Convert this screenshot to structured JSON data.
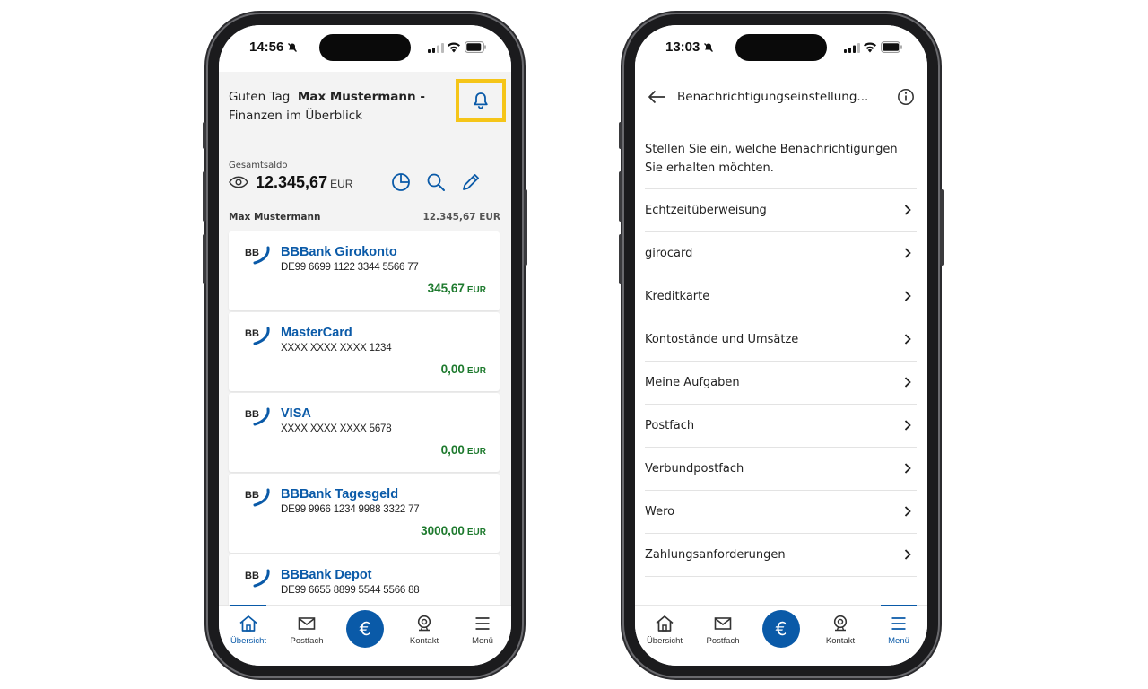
{
  "colors": {
    "brand_blue": "#0a5aa8",
    "positive_green": "#1e7a2e",
    "highlight_yellow": "#f5c518"
  },
  "left_phone": {
    "status": {
      "time": "14:56"
    },
    "greeting": {
      "prefix": "Guten Tag",
      "name": "Max Mustermann -",
      "subtitle": "Finanzen im Überblick"
    },
    "balance": {
      "label": "Gesamtsaldo",
      "amount": "12.345,67",
      "currency": "EUR"
    },
    "owner": {
      "name": "Max Mustermann",
      "total": "12.345,67 EUR"
    },
    "accounts": [
      {
        "logo": "BB",
        "name": "BBBank Girokonto",
        "number": "DE99 6699 1122 3344 5566 77",
        "amount": "345,67",
        "currency": "EUR"
      },
      {
        "logo": "BB",
        "name": "MasterCard",
        "number": "XXXX XXXX XXXX 1234",
        "amount": "0,00",
        "currency": "EUR"
      },
      {
        "logo": "BB",
        "name": "VISA",
        "number": "XXXX XXXX XXXX 5678",
        "amount": "0,00",
        "currency": "EUR"
      },
      {
        "logo": "BB",
        "name": "BBBank Tagesgeld",
        "number": "DE99 9966 1234 9988 3322 77",
        "amount": "3000,00",
        "currency": "EUR"
      },
      {
        "logo": "BB",
        "name": "BBBank Depot",
        "number": "DE99 6655 8899 5544 5566 88",
        "amount": "",
        "currency": ""
      }
    ],
    "tabs": [
      {
        "label": "Übersicht",
        "icon": "home-icon"
      },
      {
        "label": "Postfach",
        "icon": "mail-icon"
      },
      {
        "label": "€",
        "icon": "euro-icon"
      },
      {
        "label": "Kontakt",
        "icon": "contact-icon"
      },
      {
        "label": "Menü",
        "icon": "menu-icon"
      }
    ]
  },
  "right_phone": {
    "status": {
      "time": "13:03"
    },
    "title": "Benachrichtigungseinstellung...",
    "intro": "Stellen Sie ein, welche Benachrichtigungen Sie erhalten möchten.",
    "items": [
      "Echtzeitüberweisung",
      "girocard",
      "Kreditkarte",
      "Kontostände und Umsätze",
      "Meine Aufgaben",
      "Postfach",
      "Verbundpostfach",
      "Wero",
      "Zahlungsanforderungen"
    ],
    "tabs": [
      {
        "label": "Übersicht",
        "icon": "home-icon"
      },
      {
        "label": "Postfach",
        "icon": "mail-icon"
      },
      {
        "label": "€",
        "icon": "euro-icon"
      },
      {
        "label": "Kontakt",
        "icon": "contact-icon"
      },
      {
        "label": "Menü",
        "icon": "menu-icon"
      }
    ]
  }
}
